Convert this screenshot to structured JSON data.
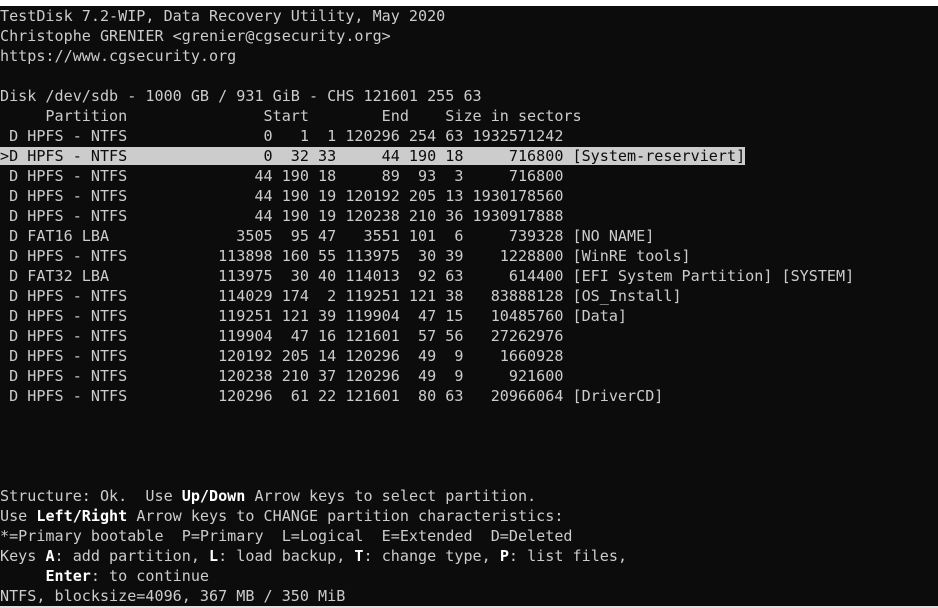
{
  "header": {
    "title_line": "TestDisk 7.2-WIP, Data Recovery Utility, May 2020",
    "author_line": "Christophe GRENIER <grenier@cgsecurity.org>",
    "url_line": "https://www.cgsecurity.org"
  },
  "disk_line": "Disk /dev/sdb - 1000 GB / 931 GiB - CHS 121601 255 63",
  "columns_line": "     Partition               Start        End    Size in sectors",
  "partitions": [
    {
      "text": " D HPFS - NTFS               0   1  1 120296 254 63 1932571242",
      "selected": false
    },
    {
      "text": ">D HPFS - NTFS               0  32 33     44 190 18     716800 [System-reserviert]",
      "selected": true
    },
    {
      "text": " D HPFS - NTFS              44 190 18     89  93  3     716800",
      "selected": false
    },
    {
      "text": " D HPFS - NTFS              44 190 19 120192 205 13 1930178560",
      "selected": false
    },
    {
      "text": " D HPFS - NTFS              44 190 19 120238 210 36 1930917888",
      "selected": false
    },
    {
      "text": " D FAT16 LBA              3505  95 47   3551 101  6     739328 [NO NAME]",
      "selected": false
    },
    {
      "text": " D HPFS - NTFS          113898 160 55 113975  30 39    1228800 [WinRE tools]",
      "selected": false
    },
    {
      "text": " D FAT32 LBA            113975  30 40 114013  92 63     614400 [EFI System Partition] [SYSTEM]",
      "selected": false
    },
    {
      "text": " D HPFS - NTFS          114029 174  2 119251 121 38   83888128 [OS_Install]",
      "selected": false
    },
    {
      "text": " D HPFS - NTFS          119251 121 39 119904  47 15   10485760 [Data]",
      "selected": false
    },
    {
      "text": " D HPFS - NTFS          119904  47 16 121601  57 56   27262976",
      "selected": false
    },
    {
      "text": " D HPFS - NTFS          120192 205 14 120296  49  9    1660928",
      "selected": false
    },
    {
      "text": " D HPFS - NTFS          120238 210 37 120296  49  9     921600",
      "selected": false
    },
    {
      "text": " D HPFS - NTFS          120296  61 22 121601  80 63   20966064 [DriverCD]",
      "selected": false
    }
  ],
  "help": {
    "structure_prefix": "Structure: Ok.  Use ",
    "structure_key": "Up/Down",
    "structure_suffix": " Arrow keys to select partition.",
    "use_prefix": "Use ",
    "use_key": "Left/Right",
    "use_suffix": " Arrow keys to CHANGE partition characteristics:",
    "legend_line": "*=Primary bootable  P=Primary  L=Logical  E=Extended  D=Deleted",
    "keys_prefix": "Keys ",
    "keys_key_a": "A",
    "keys_text_a": ": add partition, ",
    "keys_key_l": "L",
    "keys_text_l": ": load backup, ",
    "keys_key_t": "T",
    "keys_text_t": ": change type, ",
    "keys_key_p": "P",
    "keys_text_p": ": list files,",
    "enter_indent": "     ",
    "enter_key": "Enter",
    "enter_text": ": to continue",
    "status_line": "NTFS, blocksize=4096, 367 MB / 350 MiB"
  },
  "colors": {
    "background": "#0c0c0c",
    "foreground": "#cccccc",
    "highlight_bg": "#cccccc",
    "highlight_fg": "#0c0c0c",
    "emphasis": "#ffffff"
  }
}
